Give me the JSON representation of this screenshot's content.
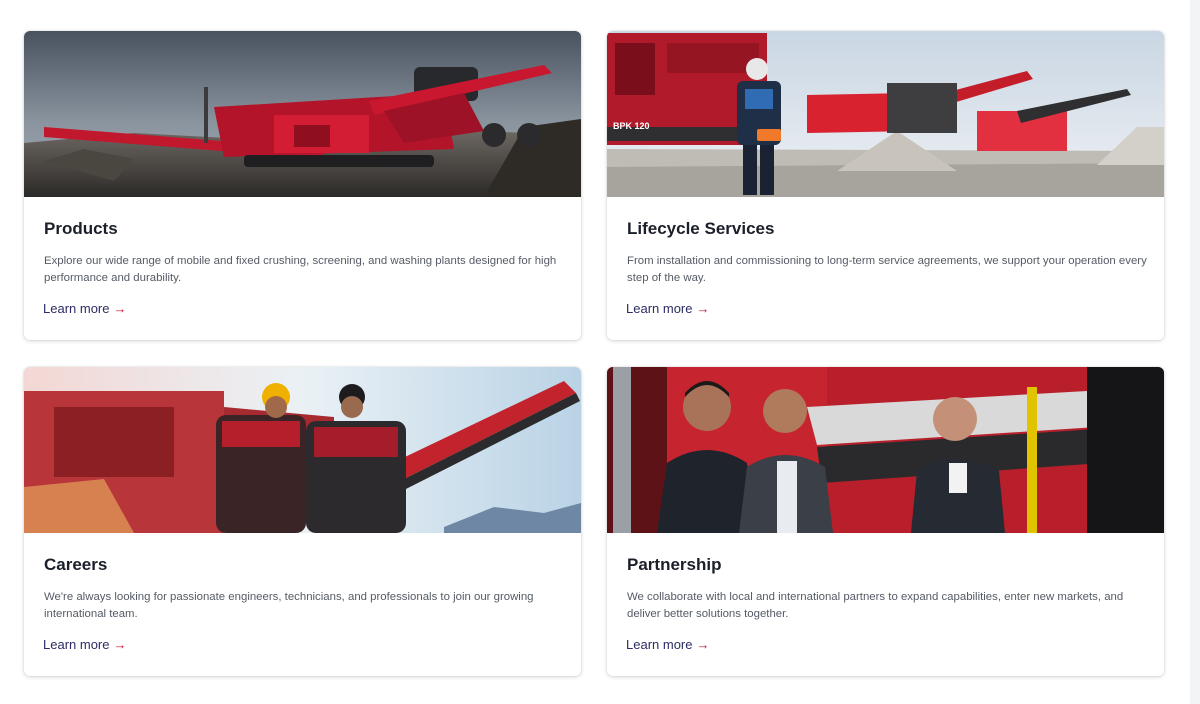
{
  "colors": {
    "brand_red": "#c4122f",
    "link_navy": "#2b2d63",
    "title": "#1b1f2a",
    "text": "#555b66"
  },
  "cards": [
    {
      "image": "mobile-screening-plant-photo",
      "title": "Products",
      "description": "Explore our wide range of mobile and fixed crushing, screening, and washing plants designed for high performance and durability.",
      "link": "Learn more",
      "arrow": "→",
      "arrow_icon": "arrow-right-icon"
    },
    {
      "image": "service-technician-site-photo",
      "title": "Lifecycle Services",
      "description": "From installation and commissioning to long-term service agreements, we support your operation every step of the way.",
      "link": "Learn more",
      "arrow": "→",
      "arrow_icon": "arrow-right-icon",
      "image_text": "BPK 120"
    },
    {
      "image": "engineers-at-plant-photo",
      "title": "Careers",
      "description": "We're always looking for passionate engineers, technicians, and professionals to join our growing international team.",
      "link": "Learn more",
      "arrow": "→",
      "arrow_icon": "arrow-right-icon"
    },
    {
      "image": "business-partners-photo",
      "title": "Partnership",
      "description": "We collaborate with local and international partners to expand capabilities, enter new markets, and deliver better solutions together.",
      "link": "Learn more",
      "arrow": "→",
      "arrow_icon": "arrow-right-icon"
    }
  ]
}
